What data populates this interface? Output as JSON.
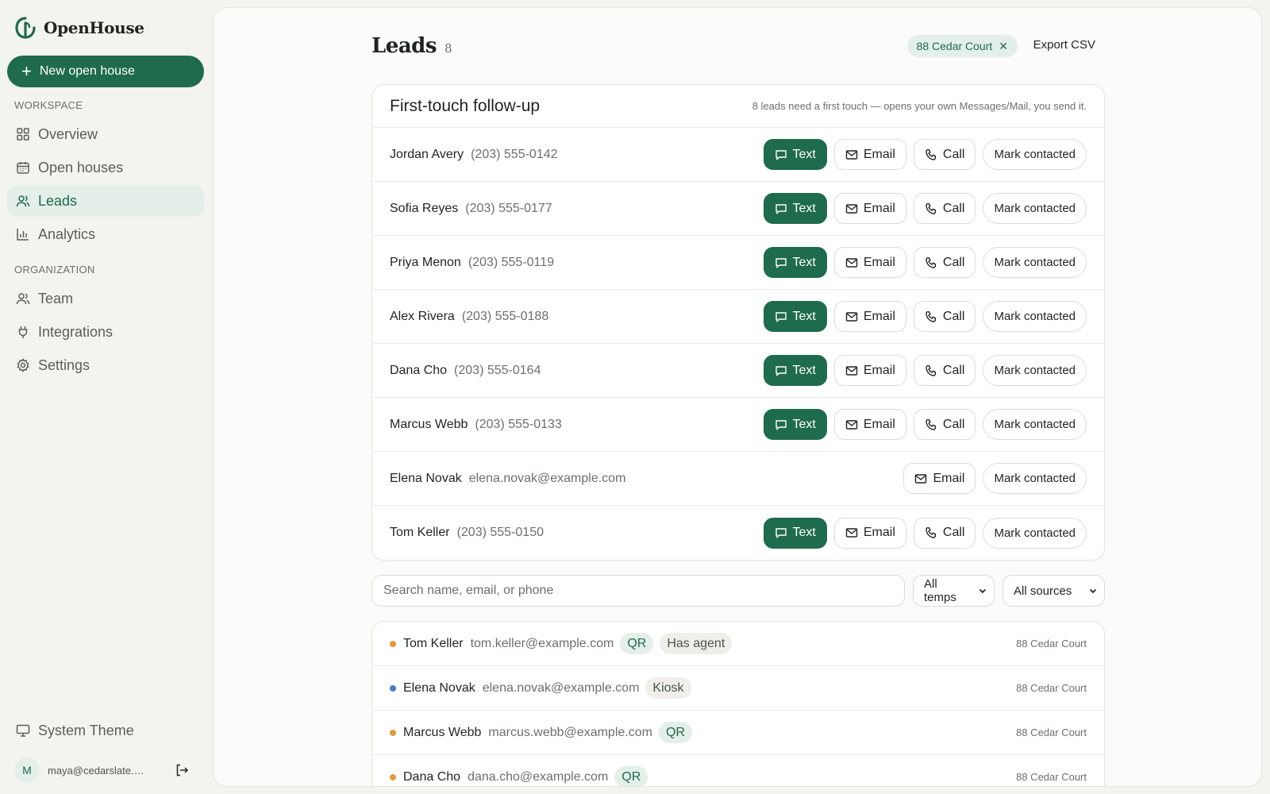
{
  "brand": {
    "name": "OpenHouse"
  },
  "sidebar": {
    "new_button": "New open house",
    "workspace_label": "WORKSPACE",
    "workspace_items": [
      {
        "label": "Overview",
        "icon": "grid-icon"
      },
      {
        "label": "Open houses",
        "icon": "calendar-icon"
      },
      {
        "label": "Leads",
        "icon": "users-icon",
        "active": true
      },
      {
        "label": "Analytics",
        "icon": "bar-chart-icon"
      }
    ],
    "organization_label": "ORGANIZATION",
    "organization_items": [
      {
        "label": "Team",
        "icon": "team-icon"
      },
      {
        "label": "Integrations",
        "icon": "plug-icon"
      },
      {
        "label": "Settings",
        "icon": "gear-icon"
      }
    ],
    "theme_label": "System Theme",
    "user": {
      "initial": "M",
      "email": "maya@cedarslate.com"
    }
  },
  "header": {
    "title": "Leads",
    "count": "8",
    "filter_chip": "88 Cedar Court",
    "export_label": "Export CSV"
  },
  "followup": {
    "title": "First-touch follow-up",
    "subtitle": "8 leads need a first touch — opens your own Messages/Mail, you send it.",
    "action_labels": {
      "text": "Text",
      "email": "Email",
      "call": "Call",
      "mark": "Mark contacted"
    },
    "rows": [
      {
        "name": "Jordan Avery",
        "contact": "(203) 555-0142",
        "has_phone": true
      },
      {
        "name": "Sofia Reyes",
        "contact": "(203) 555-0177",
        "has_phone": true
      },
      {
        "name": "Priya Menon",
        "contact": "(203) 555-0119",
        "has_phone": true
      },
      {
        "name": "Alex Rivera",
        "contact": "(203) 555-0188",
        "has_phone": true
      },
      {
        "name": "Dana Cho",
        "contact": "(203) 555-0164",
        "has_phone": true
      },
      {
        "name": "Marcus Webb",
        "contact": "(203) 555-0133",
        "has_phone": true
      },
      {
        "name": "Elena Novak",
        "contact": "elena.novak@example.com",
        "has_phone": false
      },
      {
        "name": "Tom Keller",
        "contact": "(203) 555-0150",
        "has_phone": true
      }
    ]
  },
  "filters": {
    "search_placeholder": "Search name, email, or phone",
    "temps_value": "All temps",
    "sources_value": "All sources"
  },
  "colors": {
    "accent": "#1f6b4d",
    "warm": "#e29a3c",
    "cool": "#4a7cc7"
  },
  "leads": [
    {
      "name": "Tom Keller",
      "email": "tom.keller@example.com",
      "temp_color": "#e29a3c",
      "tags": [
        {
          "label": "QR",
          "kind": "qr"
        },
        {
          "label": "Has agent",
          "kind": "neutral"
        }
      ],
      "property": "88 Cedar Court"
    },
    {
      "name": "Elena Novak",
      "email": "elena.novak@example.com",
      "temp_color": "#4a7cc7",
      "tags": [
        {
          "label": "Kiosk",
          "kind": "neutral"
        }
      ],
      "property": "88 Cedar Court"
    },
    {
      "name": "Marcus Webb",
      "email": "marcus.webb@example.com",
      "temp_color": "#e29a3c",
      "tags": [
        {
          "label": "QR",
          "kind": "qr"
        }
      ],
      "property": "88 Cedar Court"
    },
    {
      "name": "Dana Cho",
      "email": "dana.cho@example.com",
      "temp_color": "#e29a3c",
      "tags": [
        {
          "label": "QR",
          "kind": "qr"
        }
      ],
      "property": "88 Cedar Court"
    }
  ]
}
